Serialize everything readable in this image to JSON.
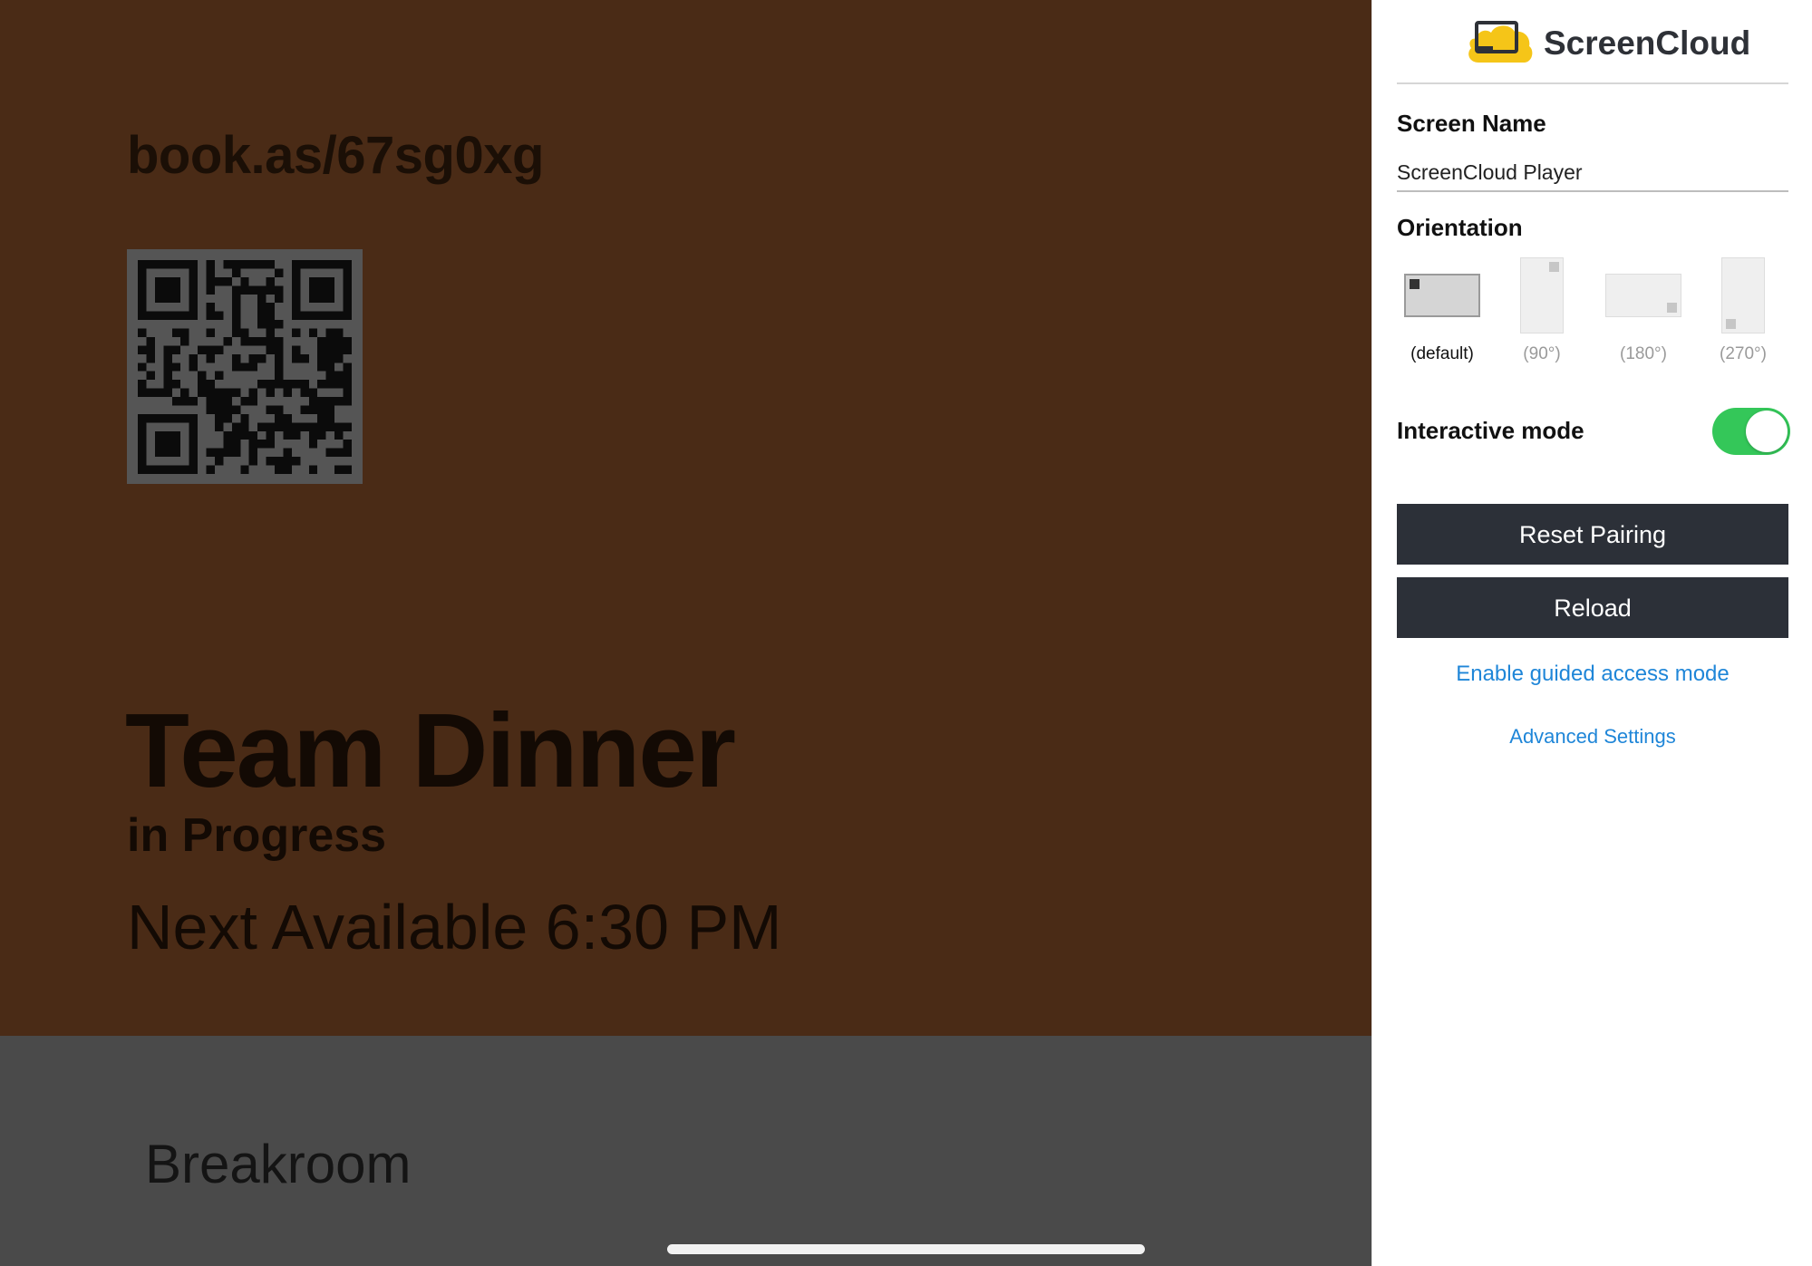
{
  "room_display": {
    "booking_url": "book.as/67sg0xg",
    "meeting_title": "Team Dinner",
    "meeting_status": "in Progress",
    "next_available": "Next Available 6:30 PM",
    "room_name": "Breakroom"
  },
  "settings_panel": {
    "brand_name": "ScreenCloud",
    "screen_name_label": "Screen Name",
    "screen_name_value": "ScreenCloud Player",
    "orientation_label": "Orientation",
    "orientations": [
      {
        "label": "(default)",
        "selected": true
      },
      {
        "label": "(90°)",
        "selected": false
      },
      {
        "label": "(180°)",
        "selected": false
      },
      {
        "label": "(270°)",
        "selected": false
      }
    ],
    "interactive_mode_label": "Interactive mode",
    "interactive_mode_on": true,
    "reset_pairing_label": "Reset Pairing",
    "reload_label": "Reload",
    "guided_access_link": "Enable guided access mode",
    "advanced_settings_link": "Advanced Settings"
  },
  "colors": {
    "room_background": "#4a2b16",
    "footer_background": "#4a4a4a",
    "toggle_on": "#34c759",
    "button_dark": "#2c3038",
    "link_blue": "#1f86d8",
    "logo_yellow": "#f5c518"
  },
  "icons": {
    "brand_logo": "screencloud-logo-icon",
    "qr": "qr-code"
  }
}
